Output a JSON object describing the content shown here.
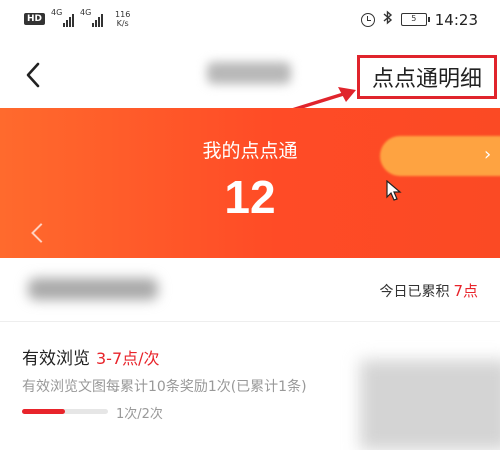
{
  "status_bar": {
    "hd": "HD",
    "network_1": "4G",
    "network_2": "4G",
    "speed_value": "116",
    "speed_unit": "K/s",
    "battery": "5",
    "time": "14:23"
  },
  "nav": {
    "back_icon": "chevron-left-icon",
    "detail_link": "点点通明细"
  },
  "banner": {
    "label": "我的点点通",
    "count": "12",
    "pill_icon": "chevron-right-icon"
  },
  "stats": {
    "today_label": "今日已累积",
    "today_points": "7点"
  },
  "task": {
    "title": "有效浏览",
    "points": "3-7点/次",
    "description": "有效浏览文图每累计10条奖励1次(已累计1条)",
    "progress_text": "1次/2次",
    "progress_fraction": 0.5
  },
  "colors": {
    "accent_red": "#e8242b",
    "banner_orange": "#ff5a28",
    "annotation_red": "#e0242c"
  }
}
